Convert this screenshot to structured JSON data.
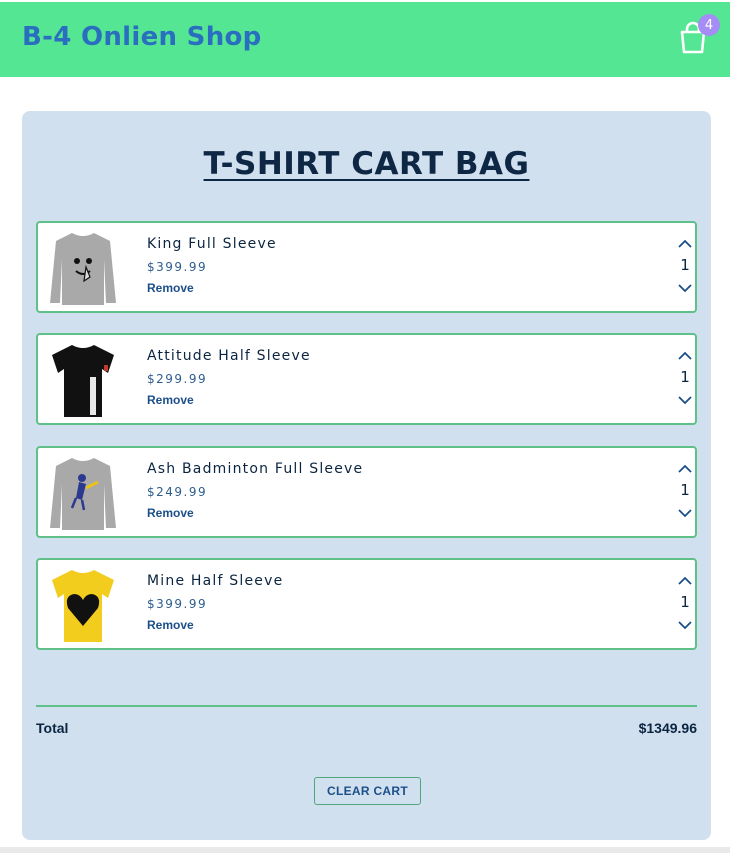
{
  "header": {
    "brand": "B-4 Onlien Shop",
    "cart_count": "4",
    "bag_icon": "shopping-bag-icon"
  },
  "cart": {
    "title": "T-SHIRT CART BAG",
    "items": [
      {
        "name": "King Full Sleeve",
        "price": "$399.99",
        "remove_label": "Remove",
        "quantity": "1",
        "shirt_color": "#a9a9a9",
        "image_icon": "gray-long-sleeve-tshirt-icon"
      },
      {
        "name": "Attitude Half Sleeve",
        "price": "$299.99",
        "remove_label": "Remove",
        "quantity": "1",
        "shirt_color": "#111111",
        "image_icon": "black-half-sleeve-tshirt-icon"
      },
      {
        "name": "Ash Badminton Full Sleeve",
        "price": "$249.99",
        "remove_label": "Remove",
        "quantity": "1",
        "shirt_color": "#a9a9a9",
        "image_icon": "gray-long-sleeve-tshirt-icon"
      },
      {
        "name": "Mine Half Sleeve",
        "price": "$399.99",
        "remove_label": "Remove",
        "quantity": "1",
        "shirt_color": "#f2cd1d",
        "image_icon": "yellow-half-sleeve-tshirt-icon"
      }
    ],
    "total_label": "Total",
    "total_value": "$1349.96",
    "clear_label": "CLEAR CART"
  },
  "colors": {
    "header_bg": "#55e693",
    "brand": "#2a6fbf",
    "panel_bg": "#d0e0ef",
    "item_border": "#5fc08a",
    "badge": "#a68cf5"
  }
}
